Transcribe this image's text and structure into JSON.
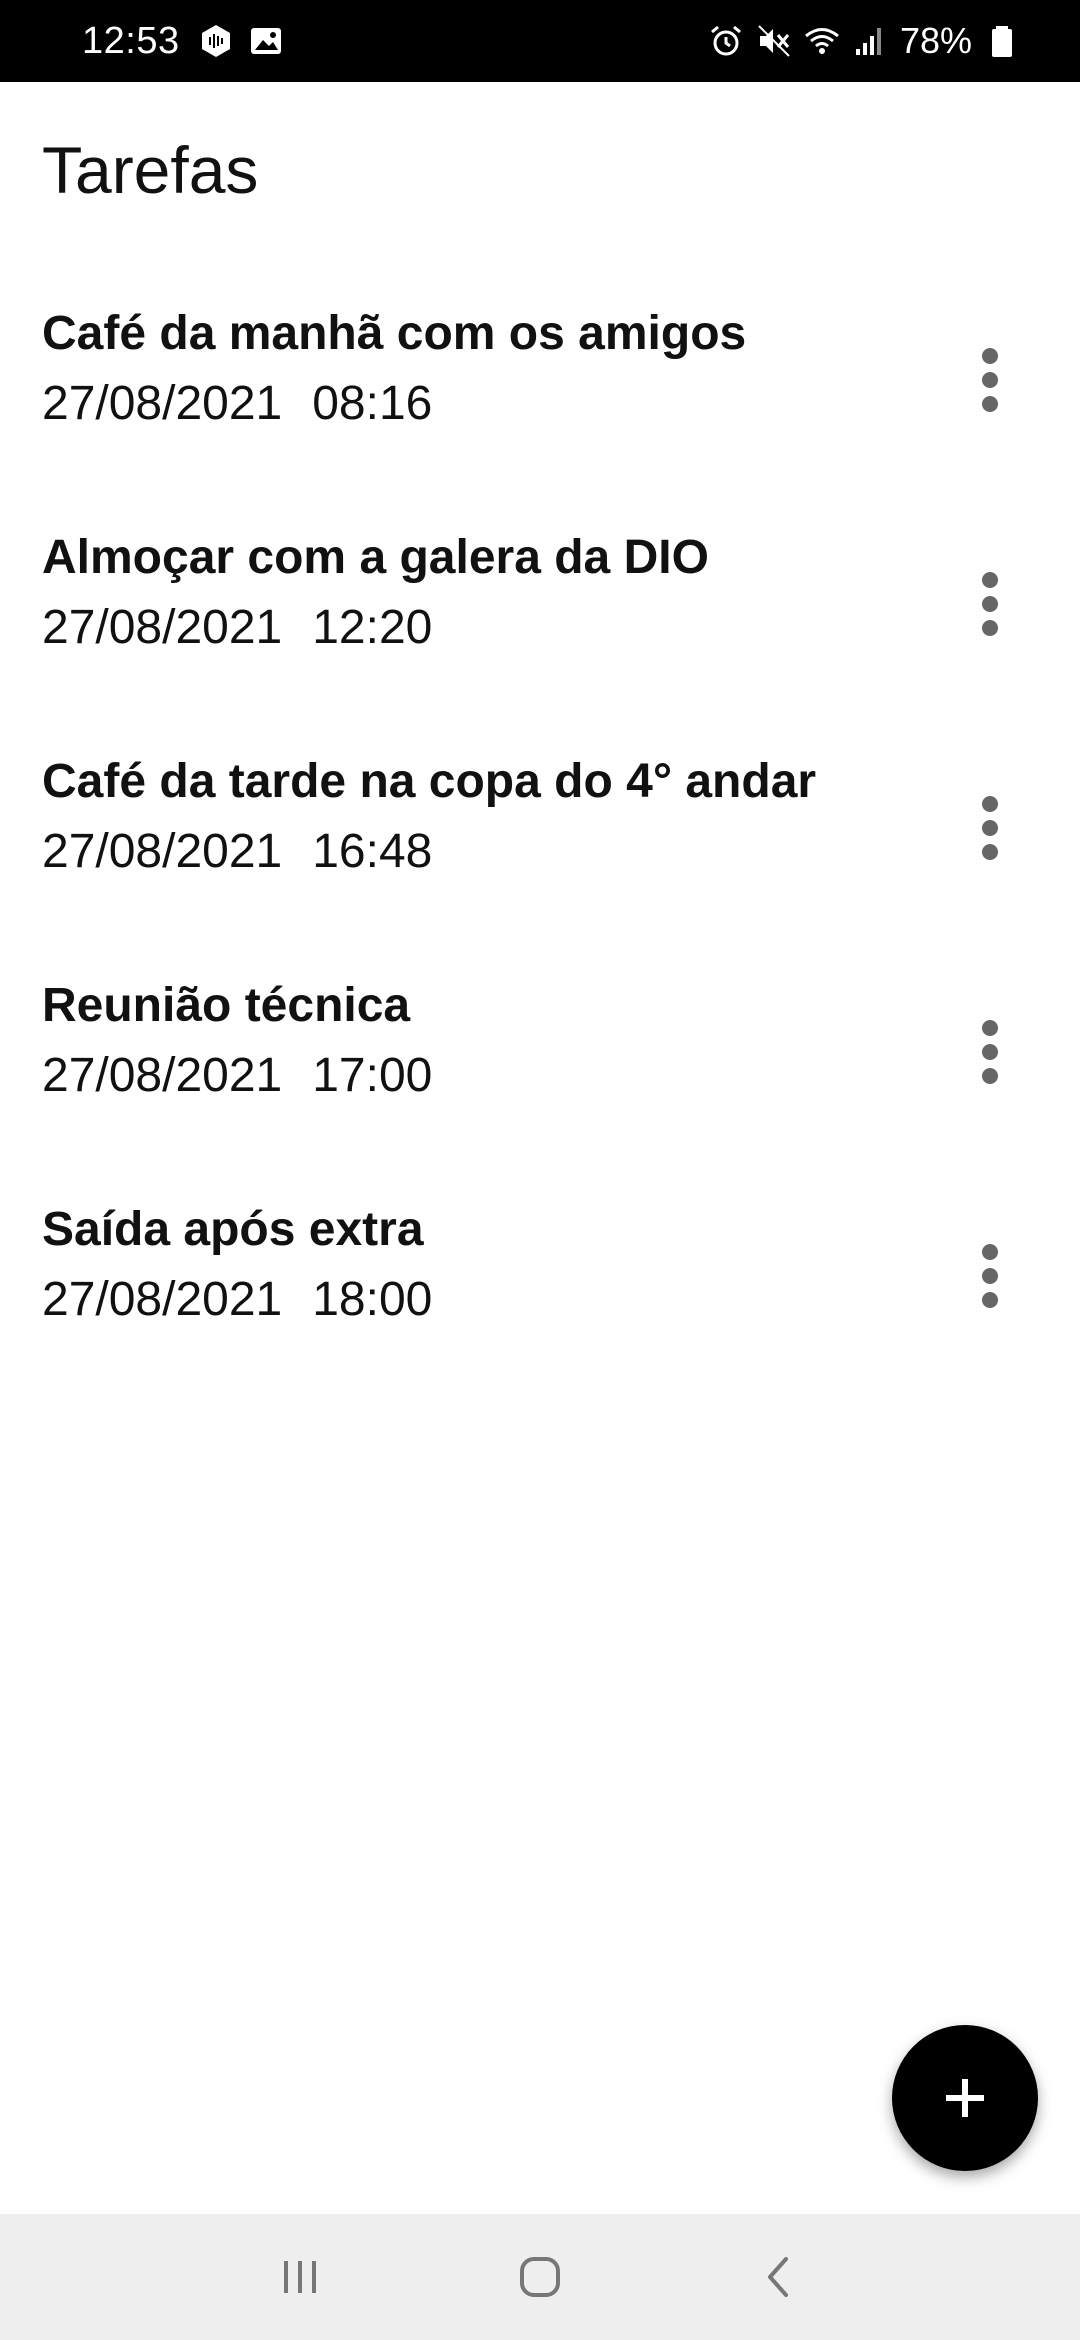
{
  "status_bar": {
    "time": "12:53",
    "battery_percent": "78%",
    "icons_left": [
      "podcast-app-icon",
      "gallery-icon"
    ],
    "icons_right": [
      "alarm-icon",
      "mute-icon",
      "wifi-icon",
      "signal-icon",
      "battery-icon"
    ]
  },
  "app": {
    "title": "Tarefas"
  },
  "tasks": [
    {
      "title": "Café da manhã com os amigos",
      "date": "27/08/2021",
      "time": "08:16"
    },
    {
      "title": "Almoçar com a galera da DIO",
      "date": "27/08/2021",
      "time": "12:20"
    },
    {
      "title": "Café da tarde na copa do 4° andar",
      "date": "27/08/2021",
      "time": "16:48"
    },
    {
      "title": "Reunião técnica",
      "date": "27/08/2021",
      "time": "17:00"
    },
    {
      "title": "Saída após extra",
      "date": "27/08/2021",
      "time": "18:00"
    }
  ],
  "fab": {
    "icon": "plus-icon"
  },
  "navigation": {
    "buttons": [
      "recent-apps-icon",
      "home-icon",
      "back-icon"
    ]
  },
  "colors": {
    "status_bar_bg": "#000000",
    "background": "#ffffff",
    "text": "#111111",
    "menu_dots": "#666666",
    "fab_bg": "#000000",
    "nav_bar_bg": "#eeeeee"
  }
}
